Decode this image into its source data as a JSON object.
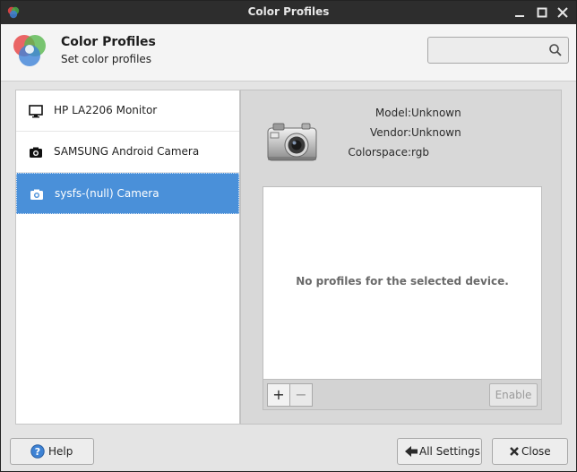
{
  "window": {
    "title": "Color Profiles"
  },
  "header": {
    "title": "Color Profiles",
    "subtitle": "Set color profiles",
    "search": {
      "value": "",
      "placeholder": ""
    }
  },
  "devices": [
    {
      "label": "HP LA2206 Monitor",
      "icon": "monitor-icon",
      "selected": false
    },
    {
      "label": "SAMSUNG Android Camera",
      "icon": "camera-icon",
      "selected": false
    },
    {
      "label": "sysfs-(null) Camera",
      "icon": "camera-icon",
      "selected": true
    }
  ],
  "details": {
    "model_label": "Model:",
    "model_value": "Unknown",
    "vendor_label": "Vendor:",
    "vendor_value": "Unknown",
    "colorspace_label": "Colorspace:",
    "colorspace_value": "rgb"
  },
  "profiles": {
    "empty_text": "No profiles for the selected device.",
    "enable_label": "Enable",
    "add_symbol": "+",
    "remove_symbol": "−"
  },
  "footer": {
    "help_label": "Help",
    "all_settings_label": "All Settings",
    "close_label": "Close"
  },
  "colors": {
    "selection": "#4a90d9",
    "titlebar": "#2d2d2d"
  }
}
